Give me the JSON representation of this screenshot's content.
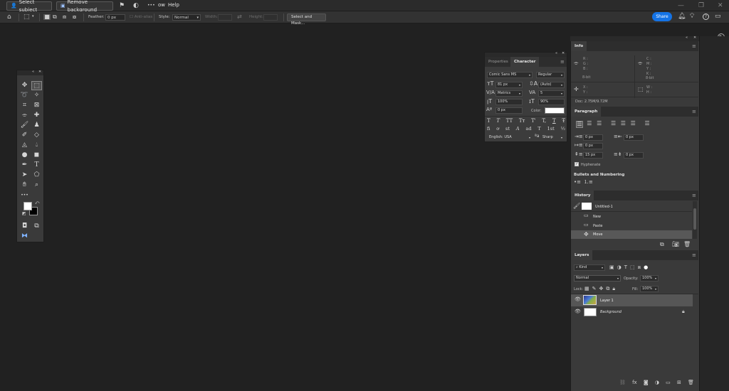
{
  "menubar": {
    "select_subject": "Select subject",
    "remove_background": "Remove background",
    "menu_tail": "ow",
    "help": "Help",
    "more": "•••"
  },
  "options": {
    "feather_label": "Feather:",
    "feather_value": "0 px",
    "antialias_label": "Anti-alias",
    "style_label": "Style:",
    "style_value": "Normal",
    "width_label": "Width:",
    "height_label": "Height:",
    "select_mask": "Select and Mask...",
    "share": "Share"
  },
  "character": {
    "tab_properties": "Properties",
    "tab_character": "Character",
    "font_family": "Comic Sans MS",
    "font_style": "Regular",
    "font_size": "81 px",
    "leading": "(Auto)",
    "kerning": "Metrics",
    "tracking": "5",
    "vscale": "100%",
    "hscale": "90%",
    "baseline": "0 px",
    "color_label": "Color:",
    "language": "English: USA",
    "antialias": "Sharp",
    "style_buttons": [
      "T",
      "T",
      "TT",
      "Tт",
      "T'",
      "T,",
      "T",
      "Ŧ"
    ],
    "ot_buttons": [
      "fi",
      "ơ",
      "st",
      "A",
      "ad",
      "T",
      "1st",
      "½"
    ]
  },
  "info": {
    "title": "Info",
    "rgb": [
      "R :",
      "G :",
      "B :"
    ],
    "cmyk": [
      "C :",
      "M :",
      "Y :",
      "K :"
    ],
    "bit_left": "8-bit",
    "bit_right": "8-bit",
    "xy": [
      "X :",
      "Y :"
    ],
    "wh": [
      "W :",
      "H :"
    ],
    "doc": "Doc: 2.75M/9.72M"
  },
  "paragraph": {
    "title": "Paragraph",
    "indent_left": "0 px",
    "indent_right": "0 px",
    "indent_first": "0 px",
    "space_before": "15 px",
    "space_after": "0 px",
    "hyphenate": "Hyphenate",
    "bullets": "Bullets and Numbering"
  },
  "history": {
    "title": "History",
    "snapshot": "Untitled-1",
    "items": [
      "New",
      "Paste",
      "Move"
    ]
  },
  "layers": {
    "title": "Layers",
    "kind": "Kind",
    "blend": "Normal",
    "opacity_label": "Opacity:",
    "opacity": "100%",
    "lock_label": "Lock:",
    "fill_label": "Fill:",
    "fill": "100%",
    "items": [
      {
        "name": "Layer 1"
      },
      {
        "name": "Background"
      }
    ]
  }
}
